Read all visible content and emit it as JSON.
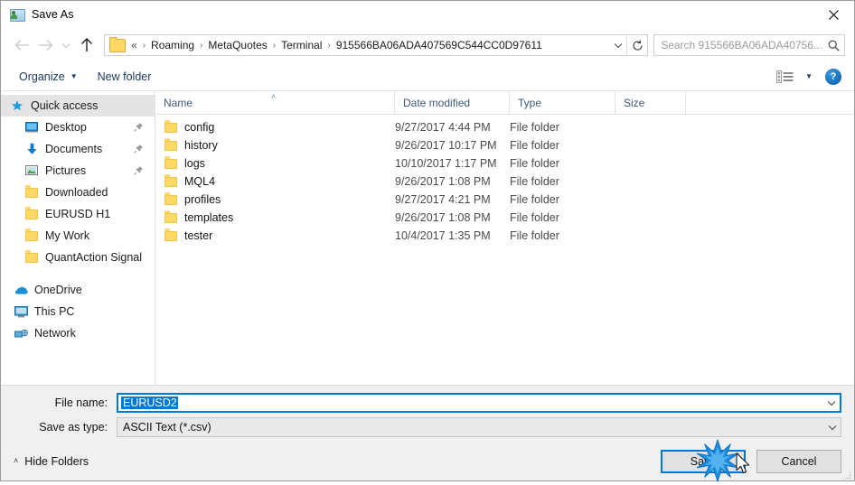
{
  "window": {
    "title": "Save As",
    "title_icon": "save-as-folder-person-icon",
    "close_icon": "close-icon"
  },
  "nav": {
    "back_icon": "arrow-left-icon",
    "forward_icon": "arrow-right-icon",
    "recent_icon": "chevron-down-icon",
    "up_icon": "arrow-up-icon",
    "refresh_icon": "refresh-icon",
    "address_folder_icon": "folder-icon",
    "breadcrumb_prefix": "«",
    "breadcrumbs": [
      "Roaming",
      "MetaQuotes",
      "Terminal",
      "915566BA06ADA407569C544CC0D97611"
    ],
    "breadcrumb_separator": "›",
    "address_dropdown_icon": "chevron-down-icon"
  },
  "search": {
    "placeholder": "Search 915566BA06ADA40756...",
    "icon": "search-icon"
  },
  "commandbar": {
    "organize_label": "Organize",
    "organize_caret": "▼",
    "new_folder_label": "New folder",
    "view_icon": "view-layout-icon",
    "view_caret": "▼",
    "help_label": "?",
    "help_icon": "help-icon"
  },
  "sidebar": {
    "items": [
      {
        "label": "Quick access",
        "icon": "star-pin-icon",
        "selected": true,
        "pinned": false,
        "indent": 0
      },
      {
        "label": "Desktop",
        "icon": "desktop-icon",
        "selected": false,
        "pinned": true,
        "indent": 1
      },
      {
        "label": "Documents",
        "icon": "documents-download-icon",
        "selected": false,
        "pinned": true,
        "indent": 1
      },
      {
        "label": "Pictures",
        "icon": "pictures-icon",
        "selected": false,
        "pinned": true,
        "indent": 1
      },
      {
        "label": "Downloaded",
        "icon": "folder-icon",
        "selected": false,
        "pinned": false,
        "indent": 1
      },
      {
        "label": "EURUSD H1",
        "icon": "folder-icon",
        "selected": false,
        "pinned": false,
        "indent": 1
      },
      {
        "label": "My Work",
        "icon": "folder-icon",
        "selected": false,
        "pinned": false,
        "indent": 1
      },
      {
        "label": "QuantAction Signal",
        "icon": "folder-icon",
        "selected": false,
        "pinned": false,
        "indent": 1
      },
      {
        "label": "OneDrive",
        "icon": "onedrive-cloud-icon",
        "selected": false,
        "pinned": false,
        "indent": 2
      },
      {
        "label": "This PC",
        "icon": "this-pc-icon",
        "selected": false,
        "pinned": false,
        "indent": 2
      },
      {
        "label": "Network",
        "icon": "network-icon",
        "selected": false,
        "pinned": false,
        "indent": 2
      }
    ]
  },
  "filelist": {
    "columns": [
      "Name",
      "Date modified",
      "Type",
      "Size"
    ],
    "sort_column": "Name",
    "sort_indicator": "˄",
    "rows": [
      {
        "name": "config",
        "date": "9/27/2017 4:44 PM",
        "type": "File folder",
        "size": "",
        "icon": "folder-icon"
      },
      {
        "name": "history",
        "date": "9/26/2017 10:17 PM",
        "type": "File folder",
        "size": "",
        "icon": "folder-icon"
      },
      {
        "name": "logs",
        "date": "10/10/2017 1:17 PM",
        "type": "File folder",
        "size": "",
        "icon": "folder-icon"
      },
      {
        "name": "MQL4",
        "date": "9/26/2017 1:08 PM",
        "type": "File folder",
        "size": "",
        "icon": "folder-icon"
      },
      {
        "name": "profiles",
        "date": "9/27/2017 4:21 PM",
        "type": "File folder",
        "size": "",
        "icon": "folder-icon"
      },
      {
        "name": "templates",
        "date": "9/26/2017 1:08 PM",
        "type": "File folder",
        "size": "",
        "icon": "folder-icon"
      },
      {
        "name": "tester",
        "date": "10/4/2017 1:35 PM",
        "type": "File folder",
        "size": "",
        "icon": "folder-icon"
      }
    ]
  },
  "form": {
    "filename_label": "File name:",
    "filename_value": "EURUSD2",
    "filename_selected": true,
    "filetype_label": "Save as type:",
    "filetype_value": "ASCII Text (*.csv)",
    "dropdown_icon": "chevron-down-icon"
  },
  "footer": {
    "hide_folders_label": "Hide Folders",
    "hide_folders_caret": "˄",
    "save_label": "Save",
    "cancel_label": "Cancel",
    "default_button": "Save",
    "resize_grip_icon": "resize-grip-icon",
    "click_indicator_icon": "click-burst-icon",
    "cursor_icon": "mouse-pointer-icon"
  },
  "colors": {
    "accent": "#0078d7",
    "folder_yellow": "#ffd966",
    "header_text": "#3c5a75",
    "form_background": "#f0f0f0",
    "selection_highlight": "#e4e4e4"
  }
}
